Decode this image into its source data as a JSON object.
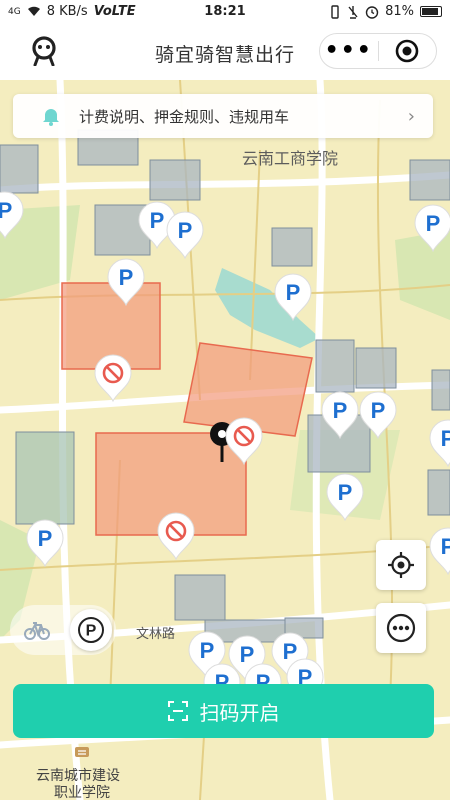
{
  "status_bar": {
    "signal": "4G",
    "speed": "8 KB/s",
    "network": "VoLTE",
    "time": "18:21",
    "battery": "81%"
  },
  "header": {
    "title": "骑宜骑智慧出行",
    "more_icon": "more-dots-icon",
    "target_icon": "mini-program-close-icon"
  },
  "notice": {
    "text": "计费说明、押金规则、违规用车"
  },
  "map_labels": {
    "school_1": "云南工商学院",
    "road": "文林路",
    "school_2_line1": "云南城市建设",
    "school_2_line2": "职业学院"
  },
  "parking_letter": "P",
  "scan_button": {
    "label": "扫码开启"
  },
  "colors": {
    "accent": "#1fcfae",
    "parking_blue": "#1e6fd0",
    "no_parking_red": "#e85a4f"
  }
}
